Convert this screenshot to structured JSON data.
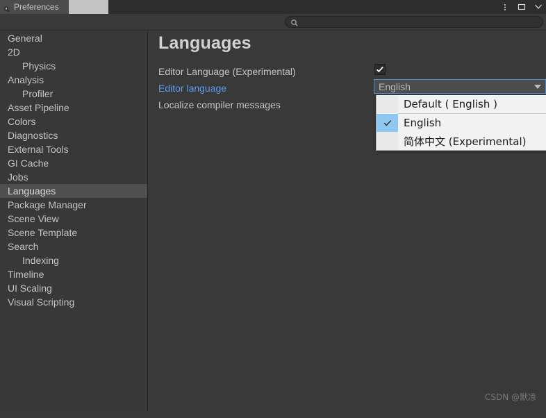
{
  "window": {
    "tab_title": "Preferences",
    "controls": [
      {
        "name": "more-menu",
        "glyph": "kebab"
      },
      {
        "name": "maximize",
        "glyph": "square"
      },
      {
        "name": "close",
        "glyph": "close"
      }
    ]
  },
  "search": {
    "value": "",
    "placeholder": "",
    "icon": "search-icon"
  },
  "sidebar": {
    "items": [
      {
        "label": "General",
        "child": false,
        "selected": false
      },
      {
        "label": "2D",
        "child": false,
        "selected": false
      },
      {
        "label": "Physics",
        "child": true,
        "selected": false
      },
      {
        "label": "Analysis",
        "child": false,
        "selected": false
      },
      {
        "label": "Profiler",
        "child": true,
        "selected": false
      },
      {
        "label": "Asset Pipeline",
        "child": false,
        "selected": false
      },
      {
        "label": "Colors",
        "child": false,
        "selected": false
      },
      {
        "label": "Diagnostics",
        "child": false,
        "selected": false
      },
      {
        "label": "External Tools",
        "child": false,
        "selected": false
      },
      {
        "label": "GI Cache",
        "child": false,
        "selected": false
      },
      {
        "label": "Jobs",
        "child": false,
        "selected": false
      },
      {
        "label": "Languages",
        "child": false,
        "selected": true
      },
      {
        "label": "Package Manager",
        "child": false,
        "selected": false
      },
      {
        "label": "Scene View",
        "child": false,
        "selected": false
      },
      {
        "label": "Scene Template",
        "child": false,
        "selected": false
      },
      {
        "label": "Search",
        "child": false,
        "selected": false
      },
      {
        "label": "Indexing",
        "child": true,
        "selected": false
      },
      {
        "label": "Timeline",
        "child": false,
        "selected": false
      },
      {
        "label": "UI Scaling",
        "child": false,
        "selected": false
      },
      {
        "label": "Visual Scripting",
        "child": false,
        "selected": false
      }
    ]
  },
  "main": {
    "title": "Languages",
    "rows": {
      "editor_language_experimental": "Editor Language (Experimental)",
      "editor_language": "Editor language",
      "localize_compiler_messages": "Localize compiler messages"
    },
    "checkbox": {
      "name": "editor-language-experimental-checkbox",
      "checked": true
    },
    "dropdown": {
      "name": "editor-language-dropdown",
      "value": "English",
      "open": true,
      "options": [
        {
          "label": "Default ( English )",
          "checked": false,
          "separator_after": true
        },
        {
          "label": "English",
          "checked": true,
          "separator_after": false
        },
        {
          "label": "简体中文 (Experimental)",
          "checked": false,
          "separator_after": false
        }
      ]
    }
  },
  "watermark": "CSDN @默凉",
  "colors": {
    "window_bg": "#393939",
    "titlebar_bg": "#c3c3c3",
    "tab_bg": "#4b4b4b",
    "sidebar_selected": "#4f4f4f",
    "text": "#c4c4c4",
    "link": "#5a9bf0",
    "focus_border": "#4d8fd6",
    "menu_bg": "#f2f2f2",
    "menu_check_bg": "#8ec7f0"
  }
}
